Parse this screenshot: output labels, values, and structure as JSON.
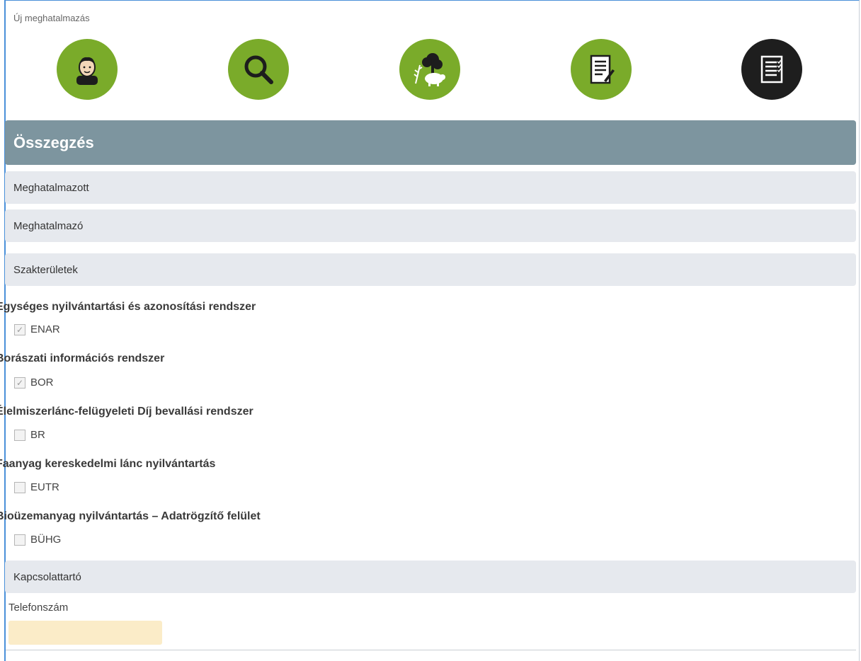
{
  "page": {
    "title": "Új meghatalmazás"
  },
  "steps": [
    {
      "icon": "person-icon",
      "state": "done"
    },
    {
      "icon": "search-icon",
      "state": "done"
    },
    {
      "icon": "farm-icon",
      "state": "done"
    },
    {
      "icon": "document-edit-icon",
      "state": "done"
    },
    {
      "icon": "checklist-icon",
      "state": "active"
    }
  ],
  "colors": {
    "step_green": "#7aab2a",
    "step_active": "#1e1e1e",
    "header": "#7d959f",
    "section": "#e6e9ee",
    "input_bg": "#fbecc8"
  },
  "summary": {
    "title": "Összegzés"
  },
  "sections": {
    "authorized": "Meghatalmazott",
    "authorizer": "Meghatalmazó",
    "domains": "Szakterületek",
    "contact": "Kapcsolattartó"
  },
  "systems": [
    {
      "title": "Egységes nyilvántartási és azonosítási rendszer",
      "code": "ENAR",
      "checked": true,
      "check_mark": "✓"
    },
    {
      "title": "Borászati információs rendszer",
      "code": "BOR",
      "checked": true,
      "check_mark": "✓"
    },
    {
      "title": "Élelmiszerlánc-felügyeleti Díj bevallási rendszer",
      "code": "BR",
      "checked": false,
      "check_mark": ""
    },
    {
      "title": "Faanyag kereskedelmi lánc nyilvántartás",
      "code": "EUTR",
      "checked": false,
      "check_mark": ""
    },
    {
      "title": "Bioüzemanyag nyilvántartás – Adatrögzítő felület",
      "code": "BÜHG",
      "checked": false,
      "check_mark": ""
    }
  ],
  "contact": {
    "phone_label": "Telefonszám",
    "phone_value": ""
  }
}
